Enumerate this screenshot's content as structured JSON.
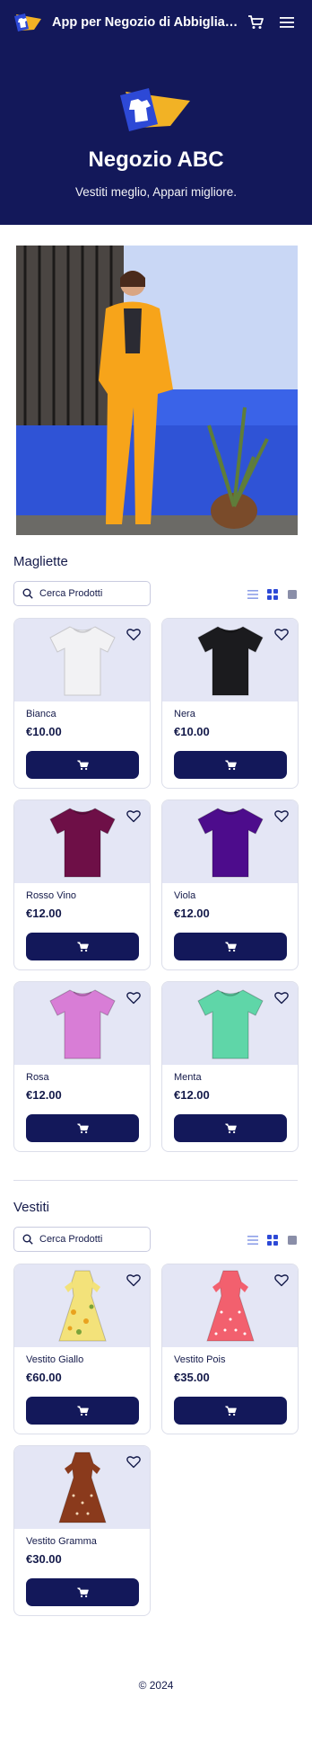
{
  "app": {
    "title": "App per Negozio di Abbigliamento"
  },
  "hero": {
    "store_name": "Negozio ABC",
    "tagline": "Vestiti meglio, Appari migliore."
  },
  "colors": {
    "navy": "#13185a",
    "card_bg": "#e4e6f5",
    "accent_blue": "#2d49d6"
  },
  "sections": [
    {
      "title": "Magliette",
      "search_placeholder": "Cerca Prodotti",
      "products": [
        {
          "name": "Bianca",
          "price": "€10.00",
          "color": "#f2f2f4"
        },
        {
          "name": "Nera",
          "price": "€10.00",
          "color": "#1b1b1e"
        },
        {
          "name": "Rosso Vino",
          "price": "€12.00",
          "color": "#6e0f47"
        },
        {
          "name": "Viola",
          "price": "€12.00",
          "color": "#4d0c8c"
        },
        {
          "name": "Rosa",
          "price": "€12.00",
          "color": "#d87dd6"
        },
        {
          "name": "Menta",
          "price": "€12.00",
          "color": "#5fd6a8"
        }
      ]
    },
    {
      "title": "Vestiti",
      "search_placeholder": "Cerca Prodotti",
      "products": [
        {
          "name": "Vestito Giallo",
          "price": "€60.00",
          "color": "#f3e27a"
        },
        {
          "name": "Vestito Pois",
          "price": "€35.00",
          "color": "#f2606e"
        },
        {
          "name": "Vestito Gramma",
          "price": "€30.00",
          "color": "#8a3a1c"
        }
      ]
    }
  ],
  "footer": {
    "text": "© 2024"
  }
}
